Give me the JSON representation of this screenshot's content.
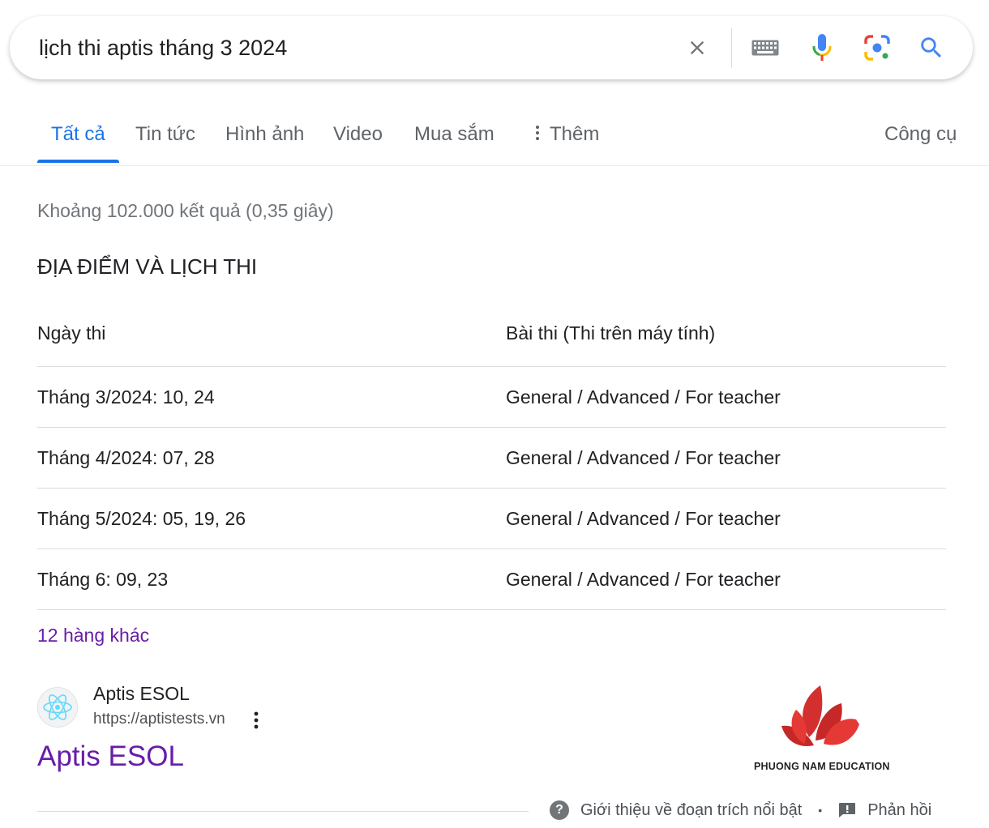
{
  "search": {
    "query": "lịch thi aptis tháng 3 2024",
    "icons": [
      "close-icon",
      "keyboard-icon",
      "mic-icon",
      "lens-icon",
      "search-icon"
    ]
  },
  "tabs": [
    {
      "label": "Tất cả",
      "active": true
    },
    {
      "label": "Tin tức"
    },
    {
      "label": "Hình ảnh"
    },
    {
      "label": "Video"
    },
    {
      "label": "Mua sắm"
    },
    {
      "label": "Thêm"
    }
  ],
  "tools_label": "Công cụ",
  "stats": "Khoảng 102.000 kết quả (0,35 giây)",
  "snippet": {
    "heading": "ĐỊA ĐIỂM VÀ LỊCH THI",
    "columns": [
      "Ngày thi",
      "Bài thi (Thi trên máy tính)"
    ],
    "rows": [
      [
        "Tháng 3/2024: 10, 24",
        "General / Advanced / For teacher"
      ],
      [
        "Tháng 4/2024: 07, 28",
        "General / Advanced / For teacher"
      ],
      [
        "Tháng 5/2024: 05, 19, 26",
        "General / Advanced / For teacher"
      ],
      [
        "Tháng 6: 09, 23",
        "General / Advanced / For teacher"
      ]
    ],
    "more_rows": "12 hàng khác"
  },
  "result": {
    "site_name": "Aptis ESOL",
    "url": "https://aptistests.vn",
    "title": "Aptis ESOL",
    "logo_text": "PHUONG NAM EDUCATION"
  },
  "footer": {
    "about": "Giới thiệu về đoạn trích nổi bật",
    "separator": "•",
    "feedback": "Phản hồi"
  },
  "colors": {
    "accent": "#1a73e8",
    "visited_link": "#681da8",
    "logo_red": "#d32f2f"
  }
}
